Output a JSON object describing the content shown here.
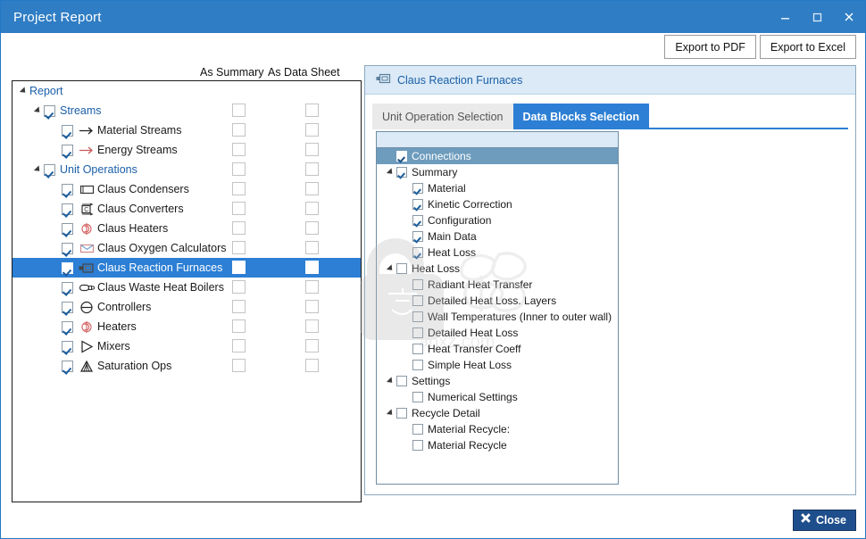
{
  "window": {
    "title": "Project Report",
    "controls": [
      {
        "name": "minimize-button",
        "glyph": "minimize"
      },
      {
        "name": "maximize-button",
        "glyph": "maximize"
      },
      {
        "name": "close-button",
        "glyph": "close"
      }
    ]
  },
  "toolbar": {
    "export_pdf_label": "Export to PDF",
    "export_excel_label": "Export to Excel"
  },
  "report_tree": {
    "column_headers": {
      "as_summary": "As Summary",
      "as_data_sheet": "As Data Sheet"
    },
    "rows": [
      {
        "label": "Report",
        "level": 0,
        "group": true,
        "expander": true,
        "checkbox": "none",
        "icon": "none",
        "col1": false,
        "col2": false,
        "selected": false
      },
      {
        "label": "Streams",
        "level": 1,
        "group": true,
        "expander": true,
        "checkbox": "checked",
        "icon": "none",
        "col1": true,
        "col2": true,
        "selected": false
      },
      {
        "label": "Material Streams",
        "level": 2,
        "group": false,
        "expander": false,
        "checkbox": "checked",
        "icon": "arrow-black-icon",
        "col1": true,
        "col2": true,
        "selected": false
      },
      {
        "label": "Energy Streams",
        "level": 2,
        "group": false,
        "expander": false,
        "checkbox": "checked",
        "icon": "arrow-red-icon",
        "col1": true,
        "col2": true,
        "selected": false
      },
      {
        "label": "Unit Operations",
        "level": 1,
        "group": true,
        "expander": true,
        "checkbox": "checked",
        "icon": "none",
        "col1": true,
        "col2": true,
        "selected": false
      },
      {
        "label": "Claus Condensers",
        "level": 2,
        "group": false,
        "expander": false,
        "checkbox": "checked",
        "icon": "condenser-icon",
        "col1": true,
        "col2": true,
        "selected": false
      },
      {
        "label": "Claus Converters",
        "level": 2,
        "group": false,
        "expander": false,
        "checkbox": "checked",
        "icon": "converter-icon",
        "col1": true,
        "col2": true,
        "selected": false
      },
      {
        "label": "Claus Heaters",
        "level": 2,
        "group": false,
        "expander": false,
        "checkbox": "checked",
        "icon": "heater-icon",
        "col1": true,
        "col2": true,
        "selected": false
      },
      {
        "label": "Claus Oxygen Calculators",
        "level": 2,
        "group": false,
        "expander": false,
        "checkbox": "checked",
        "icon": "oxygen-calc-icon",
        "col1": true,
        "col2": true,
        "selected": false
      },
      {
        "label": "Claus Reaction Furnaces",
        "level": 2,
        "group": false,
        "expander": false,
        "checkbox": "checked",
        "icon": "furnace-icon",
        "col1": true,
        "col2": true,
        "selected": true
      },
      {
        "label": "Claus Waste Heat Boilers",
        "level": 2,
        "group": false,
        "expander": false,
        "checkbox": "checked",
        "icon": "boiler-icon",
        "col1": true,
        "col2": true,
        "selected": false
      },
      {
        "label": "Controllers",
        "level": 2,
        "group": false,
        "expander": false,
        "checkbox": "checked",
        "icon": "controller-icon",
        "col1": true,
        "col2": true,
        "selected": false
      },
      {
        "label": "Heaters",
        "level": 2,
        "group": false,
        "expander": false,
        "checkbox": "checked",
        "icon": "heater-icon",
        "col1": true,
        "col2": true,
        "selected": false
      },
      {
        "label": "Mixers",
        "level": 2,
        "group": false,
        "expander": false,
        "checkbox": "checked",
        "icon": "mixer-icon",
        "col1": true,
        "col2": true,
        "selected": false
      },
      {
        "label": "Saturation Ops",
        "level": 2,
        "group": false,
        "expander": false,
        "checkbox": "checked",
        "icon": "saturation-icon",
        "col1": true,
        "col2": true,
        "selected": false
      }
    ]
  },
  "detail_panel": {
    "header_title": "Claus Reaction Furnaces",
    "header_icon": "furnace-icon",
    "tabs": [
      {
        "label": "Unit Operation Selection",
        "active": false
      },
      {
        "label": "Data Blocks Selection",
        "active": true
      }
    ],
    "blocks": [
      {
        "label": "Connections",
        "level": 0,
        "expander": false,
        "checked": true,
        "selected": true
      },
      {
        "label": "Summary",
        "level": 0,
        "expander": true,
        "checked": true,
        "selected": false
      },
      {
        "label": "Material",
        "level": 1,
        "expander": false,
        "checked": true,
        "selected": false
      },
      {
        "label": "Kinetic Correction",
        "level": 1,
        "expander": false,
        "checked": true,
        "selected": false
      },
      {
        "label": "Configuration",
        "level": 1,
        "expander": false,
        "checked": true,
        "selected": false
      },
      {
        "label": "Main Data",
        "level": 1,
        "expander": false,
        "checked": true,
        "selected": false
      },
      {
        "label": "Heat Loss",
        "level": 1,
        "expander": false,
        "checked": true,
        "selected": false
      },
      {
        "label": "Heat Loss",
        "level": 0,
        "expander": true,
        "checked": false,
        "selected": false
      },
      {
        "label": "Radiant Heat Transfer",
        "level": 1,
        "expander": false,
        "checked": false,
        "selected": false
      },
      {
        "label": "Detailed Heat Loss. Layers",
        "level": 1,
        "expander": false,
        "checked": false,
        "selected": false
      },
      {
        "label": "Wall Temperatures (Inner to outer wall)",
        "level": 1,
        "expander": false,
        "checked": false,
        "selected": false
      },
      {
        "label": "Detailed Heat Loss",
        "level": 1,
        "expander": false,
        "checked": false,
        "selected": false
      },
      {
        "label": "Heat Transfer Coeff",
        "level": 1,
        "expander": false,
        "checked": false,
        "selected": false
      },
      {
        "label": "Simple Heat Loss",
        "level": 1,
        "expander": false,
        "checked": false,
        "selected": false
      },
      {
        "label": "Settings",
        "level": 0,
        "expander": true,
        "checked": false,
        "selected": false
      },
      {
        "label": "Numerical Settings",
        "level": 1,
        "expander": false,
        "checked": false,
        "selected": false
      },
      {
        "label": "Recycle Detail",
        "level": 0,
        "expander": true,
        "checked": false,
        "selected": false
      },
      {
        "label": "Material Recycle:",
        "level": 1,
        "expander": false,
        "checked": false,
        "selected": false
      },
      {
        "label": "Material Recycle",
        "level": 1,
        "expander": false,
        "checked": false,
        "selected": false
      }
    ]
  },
  "footer": {
    "close_label": "Close",
    "close_icon": "x-icon"
  },
  "watermark": {
    "text": "anxz.com",
    "cjk": "载下"
  },
  "colors": {
    "titlebar": "#2f7dc4",
    "accent": "#2c7fd4",
    "group_text": "#1a5fa8",
    "panel_header_bg": "#dbeaf6",
    "block_selected_bg": "#6e9cbd",
    "close_button_bg": "#1f4e8c"
  }
}
